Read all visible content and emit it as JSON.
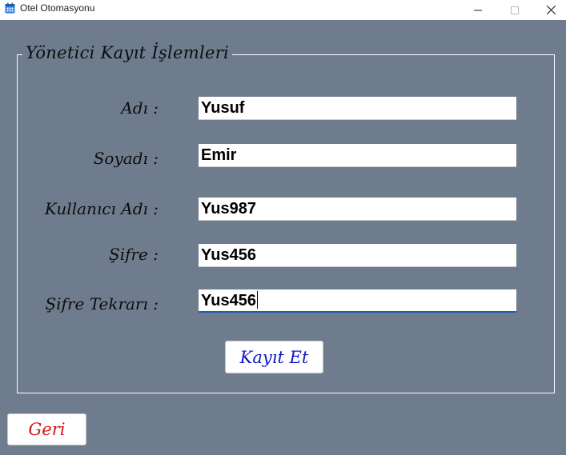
{
  "window": {
    "title": "Otel Otomasyonu",
    "icon": "calendar-icon",
    "controls": [
      "minimize-icon",
      "maximize-icon",
      "close-icon"
    ]
  },
  "group": {
    "title": "Yönetici Kayıt İşlemleri"
  },
  "form": {
    "first_name": {
      "label": "Adı :",
      "value": "Yusuf"
    },
    "last_name": {
      "label": "Soyadı :",
      "value": "Emir"
    },
    "username": {
      "label": "Kullanıcı Adı :",
      "value": "Yus987"
    },
    "password": {
      "label": "Şifre :",
      "value": "Yus456"
    },
    "password_repeat": {
      "label": "Şifre Tekrarı :",
      "value": "Yus456"
    }
  },
  "buttons": {
    "save_label": "Kayıt Et",
    "back_label": "Geri"
  },
  "colors": {
    "background": "#6f7c8e",
    "save_text": "#1018c8",
    "back_text": "#d41414",
    "focus_underline": "#1a5fb4"
  }
}
